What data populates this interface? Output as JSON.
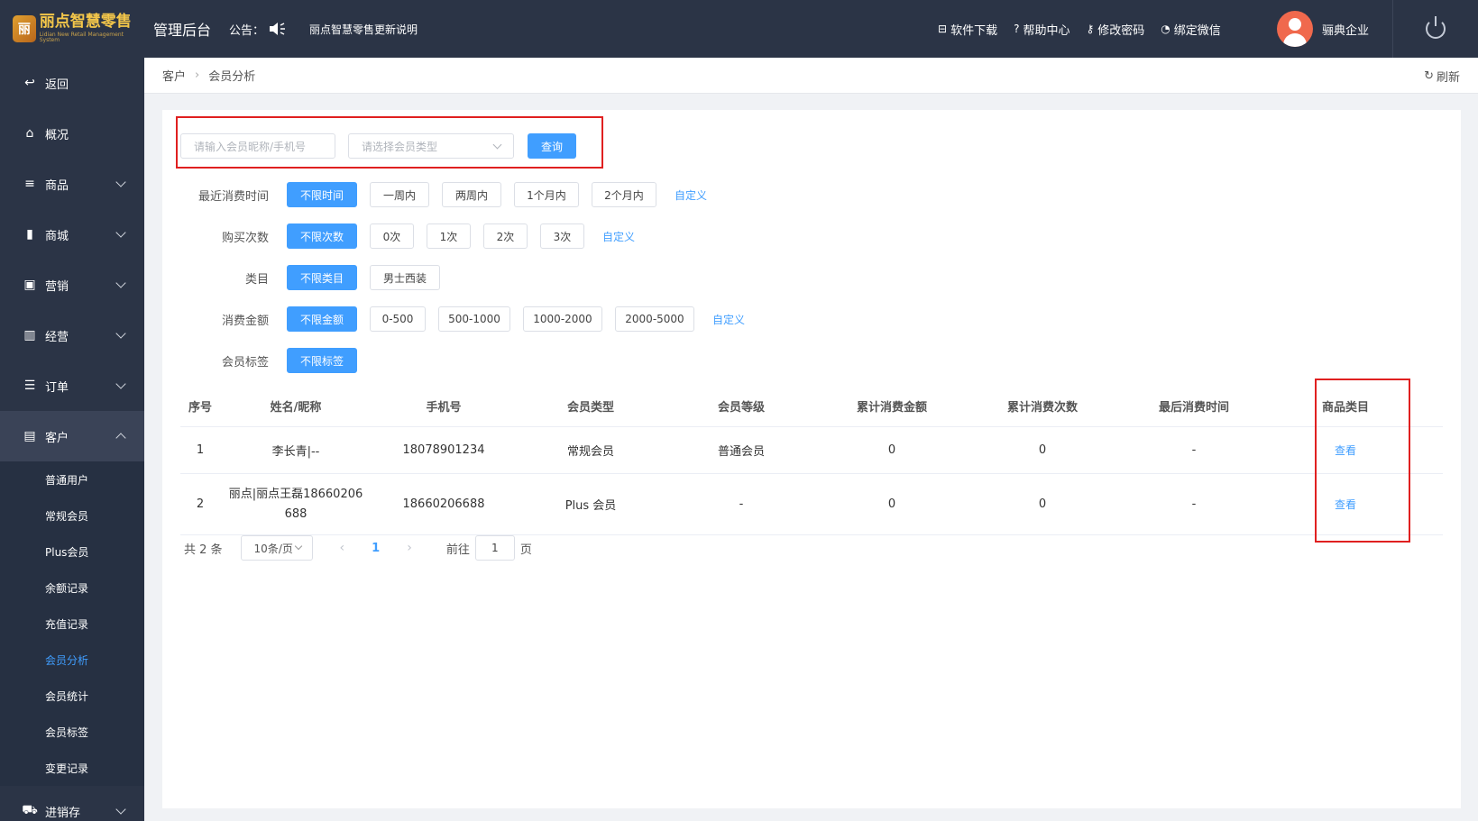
{
  "header": {
    "logo_cn": "丽点智慧零售",
    "logo_en": "Lidian New Retail Management System",
    "admin_title": "管理后台",
    "notice_label": "公告：",
    "notice_text": "丽点智慧零售更新说明",
    "links": [
      {
        "icon": "download-icon",
        "label": "软件下载"
      },
      {
        "icon": "help-icon",
        "label": "帮助中心"
      },
      {
        "icon": "key-icon",
        "label": "修改密码"
      },
      {
        "icon": "wechat-icon",
        "label": "绑定微信"
      }
    ],
    "user_name": "骊典企业"
  },
  "sidebar": {
    "items": [
      {
        "icon": "back-arrow-icon",
        "label": "返回"
      },
      {
        "icon": "home-icon",
        "label": "概况"
      },
      {
        "icon": "list-icon",
        "label": "商品"
      },
      {
        "icon": "bag-icon",
        "label": "商城"
      },
      {
        "icon": "gift-icon",
        "label": "营销"
      },
      {
        "icon": "bar-chart-icon",
        "label": "经营"
      },
      {
        "icon": "order-list-icon",
        "label": "订单"
      },
      {
        "icon": "id-card-icon",
        "label": "客户"
      },
      {
        "icon": "truck-icon",
        "label": "进销存"
      }
    ],
    "sub_items": [
      "普通用户",
      "常规会员",
      "Plus会员",
      "余额记录",
      "充值记录",
      "会员分析",
      "会员统计",
      "会员标签",
      "变更记录"
    ],
    "active_sub": "会员分析"
  },
  "breadcrumb": {
    "parent": "客户",
    "current": "会员分析",
    "refresh_label": "刷新"
  },
  "search": {
    "name_placeholder": "请输入会员昵称/手机号",
    "type_placeholder": "请选择会员类型",
    "query_label": "查询"
  },
  "filters": [
    {
      "label": "最近消费时间",
      "options": [
        "不限时间",
        "一周内",
        "两周内",
        "1个月内",
        "2个月内"
      ],
      "custom": "自定义"
    },
    {
      "label": "购买次数",
      "options": [
        "不限次数",
        "0次",
        "1次",
        "2次",
        "3次"
      ],
      "custom": "自定义"
    },
    {
      "label": "类目",
      "options": [
        "不限类目",
        "男士西装"
      ],
      "custom": ""
    },
    {
      "label": "消费金额",
      "options": [
        "不限金额",
        "0-500",
        "500-1000",
        "1000-2000",
        "2000-5000"
      ],
      "custom": "自定义"
    },
    {
      "label": "会员标签",
      "options": [
        "不限标签"
      ],
      "custom": ""
    }
  ],
  "table": {
    "headers": [
      "序号",
      "姓名/昵称",
      "手机号",
      "会员类型",
      "会员等级",
      "累计消费金额",
      "累计消费次数",
      "最后消费时间",
      "商品类目"
    ],
    "rows": [
      [
        "1",
        "李长青|--",
        "18078901234",
        "常规会员",
        "普通会员",
        "0",
        "0",
        "-",
        "查看"
      ],
      [
        "2",
        "丽点|丽点王磊18660206688",
        "18660206688",
        "Plus 会员",
        "-",
        "0",
        "0",
        "-",
        "查看"
      ]
    ],
    "row2_name_line1": "丽点|丽点王磊18660206",
    "row2_name_line2": "688"
  },
  "pager": {
    "total": "共 2 条",
    "page_size": "10条/页",
    "prev": "‹",
    "current_page": "1",
    "next": "›",
    "goto_label": "前往",
    "goto_value": "1",
    "page_unit": "页"
  },
  "colors": {
    "accent": "#409eff",
    "sidebar_bg": "#2b3446",
    "highlight_box": "#e02020"
  }
}
